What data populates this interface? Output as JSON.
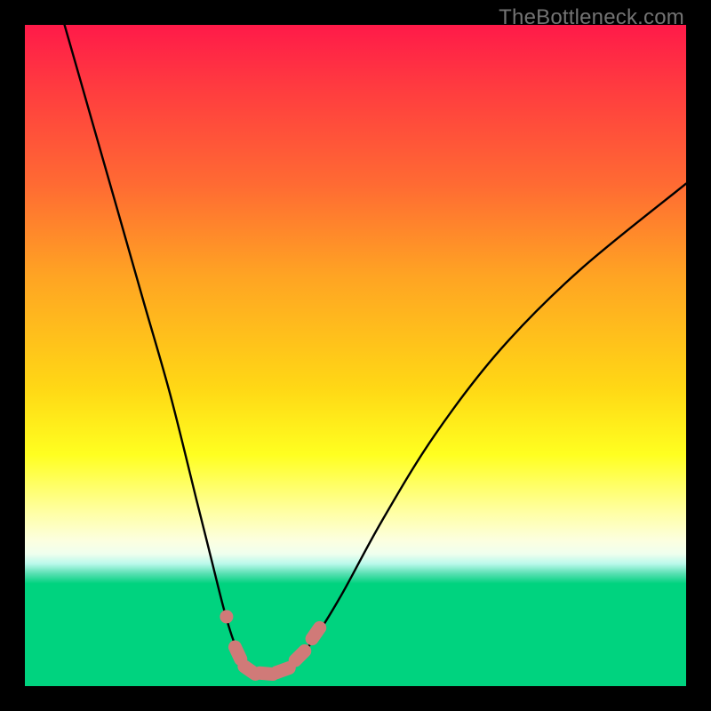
{
  "watermark": "TheBottleneck.com",
  "chart_data": {
    "type": "line",
    "title": "",
    "xlabel": "",
    "ylabel": "",
    "xlim": [
      0,
      100
    ],
    "ylim": [
      0,
      100
    ],
    "background_gradient": {
      "top": "#ff1a49",
      "mid": "#ffff20",
      "bottom": "#00d37f"
    },
    "series": [
      {
        "name": "bottleneck-curve",
        "color": "#000000",
        "x": [
          6,
          10,
          14,
          18,
          22,
          26,
          28,
          30,
          31.5,
          33,
          34,
          35,
          37,
          39,
          41,
          44,
          48,
          54,
          62,
          72,
          84,
          100
        ],
        "y": [
          100,
          86,
          72,
          58,
          44,
          28,
          20,
          12,
          7,
          3.5,
          2.2,
          2,
          2,
          2.4,
          3.8,
          7.5,
          14,
          25,
          38,
          51,
          63,
          76
        ]
      }
    ],
    "markers": {
      "name": "dash-markers",
      "color": "#d07a78",
      "points": [
        {
          "x": 30.5,
          "y": 10.5,
          "shape": "dot"
        },
        {
          "x": 32.2,
          "y": 5.0,
          "shape": "dash",
          "angle": 65
        },
        {
          "x": 34.0,
          "y": 2.4,
          "shape": "dash",
          "angle": 35
        },
        {
          "x": 36.5,
          "y": 1.9,
          "shape": "dash",
          "angle": 5
        },
        {
          "x": 39.0,
          "y": 2.4,
          "shape": "dash",
          "angle": -20
        },
        {
          "x": 41.6,
          "y": 4.6,
          "shape": "dash",
          "angle": -45
        },
        {
          "x": 44.0,
          "y": 8.0,
          "shape": "dash",
          "angle": -55
        }
      ]
    }
  }
}
